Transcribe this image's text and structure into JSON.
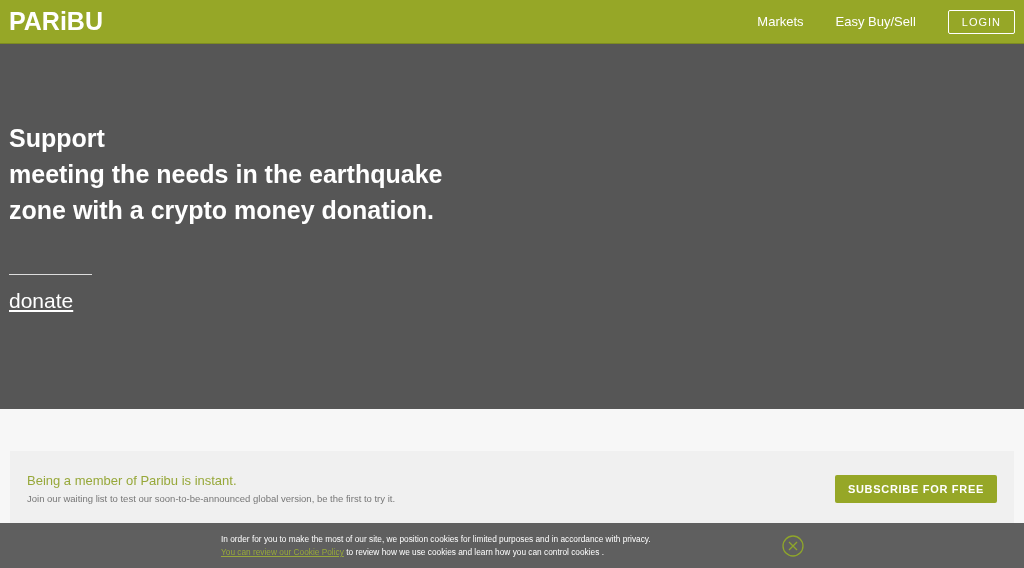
{
  "header": {
    "logo": "PARiBU",
    "nav": [
      {
        "label": "Markets"
      },
      {
        "label": "Easy Buy/Sell"
      }
    ],
    "login": "LOGIN"
  },
  "hero": {
    "lines": [
      "Support",
      "meeting the needs in the earthquake",
      "zone with a crypto money donation."
    ],
    "link": "donate"
  },
  "signup": {
    "title": "Being a member of Paribu is instant.",
    "text": "Join our waiting list to test our soon-to-be-announced global version, be the first to try it.",
    "button": "SUBSCRIBE FOR FREE"
  },
  "cookie_bar": {
    "text": "In order for you to make the most of our site, we position cookies for limited purposes and in accordance with privacy.",
    "link": "You can review our Cookie Policy",
    "text_after": "to review how we use cookies and learn how you can control cookies ."
  }
}
